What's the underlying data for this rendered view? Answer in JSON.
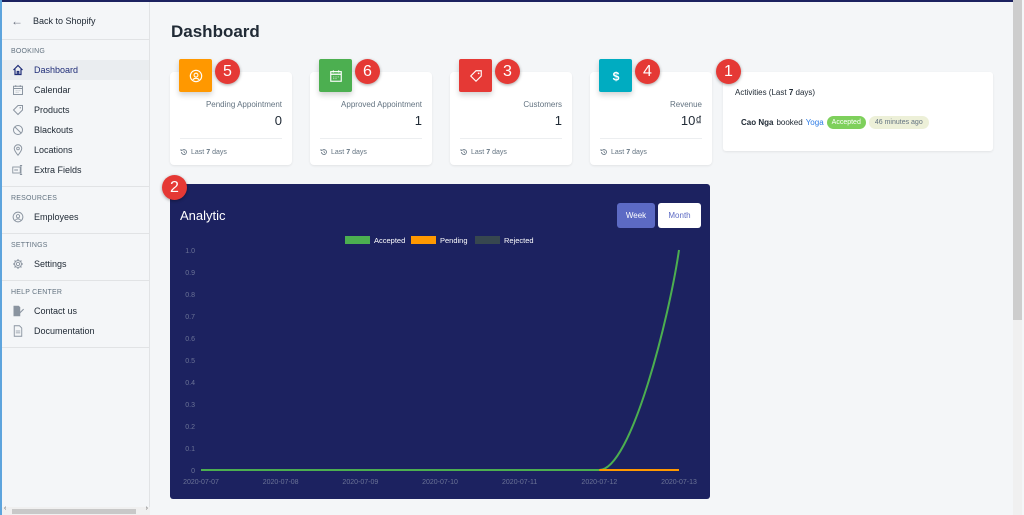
{
  "sidebar": {
    "back_label": "Back to Shopify",
    "sections": [
      {
        "title": "BOOKING",
        "items": [
          {
            "label": "Dashboard",
            "icon": "home-icon",
            "active": true
          },
          {
            "label": "Calendar",
            "icon": "calendar-icon"
          },
          {
            "label": "Products",
            "icon": "tag-icon"
          },
          {
            "label": "Blackouts",
            "icon": "block-icon"
          },
          {
            "label": "Locations",
            "icon": "location-pin-icon"
          },
          {
            "label": "Extra Fields",
            "icon": "text-field-icon"
          }
        ]
      },
      {
        "title": "RESOURCES",
        "items": [
          {
            "label": "Employees",
            "icon": "user-circle-icon"
          }
        ]
      },
      {
        "title": "SETTINGS",
        "items": [
          {
            "label": "Settings",
            "icon": "gear-icon"
          }
        ]
      },
      {
        "title": "HELP CENTER",
        "items": [
          {
            "label": "Contact us",
            "icon": "edit-document-icon"
          },
          {
            "label": "Documentation",
            "icon": "document-icon"
          }
        ]
      }
    ]
  },
  "page": {
    "title": "Dashboard"
  },
  "cards": [
    {
      "label": "Pending Appointment",
      "value": "0",
      "footer_pre": "Last",
      "footer_num": "7",
      "footer_post": "days",
      "icon": "user-circle-icon",
      "color": "#ff9800",
      "marker": "5"
    },
    {
      "label": "Approved Appointment",
      "value": "1",
      "footer_pre": "Last",
      "footer_num": "7",
      "footer_post": "days",
      "icon": "calendar-icon",
      "color": "#4caf50",
      "marker": "6"
    },
    {
      "label": "Customers",
      "value": "1",
      "footer_pre": "Last",
      "footer_num": "7",
      "footer_post": "days",
      "icon": "tag-icon",
      "color": "#e53935",
      "marker": "3"
    },
    {
      "label": "Revenue",
      "value": "10₫",
      "footer_pre": "Last",
      "footer_num": "7",
      "footer_post": "days",
      "icon": "dollar-icon",
      "color": "#00acc1",
      "marker": "4"
    }
  ],
  "activities": {
    "title_pre": "Activities (Last",
    "title_num": "7",
    "title_post": "days)",
    "marker": "1",
    "items": [
      {
        "customer": "Cao Nga",
        "verb": "booked",
        "service": "Yoga",
        "status": "Accepted",
        "time": "46 minutes ago"
      }
    ]
  },
  "analytic": {
    "title": "Analytic",
    "marker": "2",
    "week_label": "Week",
    "month_label": "Month",
    "active_range": "Week"
  },
  "chart_data": {
    "type": "line",
    "title": "Analytic",
    "x": [
      "2020-07-07",
      "2020-07-08",
      "2020-07-09",
      "2020-07-10",
      "2020-07-11",
      "2020-07-12",
      "2020-07-13"
    ],
    "series": [
      {
        "name": "Accepted",
        "color": "#4caf50",
        "values": [
          0,
          0,
          0,
          0,
          0,
          0,
          1
        ]
      },
      {
        "name": "Pending",
        "color": "#ff9800",
        "values": [
          0,
          0,
          0,
          0,
          0,
          0,
          0
        ]
      },
      {
        "name": "Rejected",
        "color": "#37474f",
        "values": [
          0,
          0,
          0,
          0,
          0,
          0,
          0
        ]
      }
    ],
    "ylim": [
      0,
      1.0
    ],
    "yticks": [
      "0",
      "0.1",
      "0.2",
      "0.3",
      "0.4",
      "0.5",
      "0.6",
      "0.7",
      "0.8",
      "0.9",
      "1.0"
    ],
    "legend": "top-center",
    "xlabel": "",
    "ylabel": "",
    "grid": false
  }
}
